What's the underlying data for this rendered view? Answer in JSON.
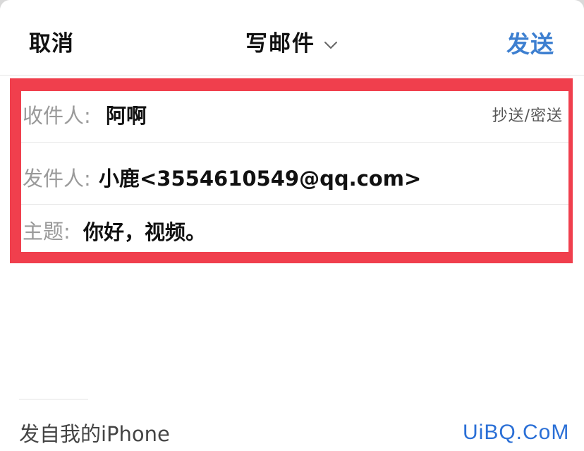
{
  "navbar": {
    "cancel_label": "取消",
    "title": "写邮件",
    "title_icon": "chevron-down-icon",
    "send_label": "发送"
  },
  "fields": {
    "to": {
      "label": "收件人:",
      "value": "阿啊",
      "cc_bcc_label": "抄送/密送"
    },
    "from": {
      "label": "发件人:",
      "value": "小鹿<3554610549@qq.com>"
    },
    "subject": {
      "label": "主题:",
      "value": "你好，视频。"
    }
  },
  "body": {
    "signature": "发自我的iPhone"
  },
  "watermark": "UiBQ.CoM",
  "colors": {
    "accent": "#3d7fd0",
    "highlight_border": "#f03f4d",
    "label_gray": "#9a9a9a"
  }
}
